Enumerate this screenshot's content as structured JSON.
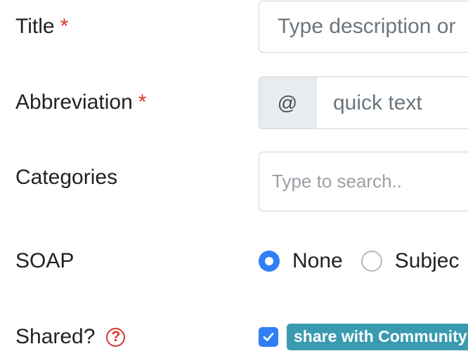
{
  "form": {
    "title": {
      "label": "Title",
      "required_mark": "*",
      "placeholder": "Type description or"
    },
    "abbreviation": {
      "label": "Abbreviation",
      "required_mark": "*",
      "prefix": "@",
      "placeholder": "quick text"
    },
    "categories": {
      "label": "Categories",
      "placeholder": "Type to search.."
    },
    "soap": {
      "label": "SOAP",
      "options": [
        {
          "label": "None",
          "checked": true
        },
        {
          "label": "Subjec",
          "checked": false
        }
      ]
    },
    "shared": {
      "label": "Shared?",
      "help_icon": "question-circle-icon",
      "help_glyph": "?",
      "checked": true,
      "badge": "share with Community"
    }
  },
  "colors": {
    "required": "#d9362b",
    "primary": "#2f7ff5",
    "badge": "#3a9bb0",
    "addon_bg": "#e9ecef",
    "border": "#ced4da"
  }
}
